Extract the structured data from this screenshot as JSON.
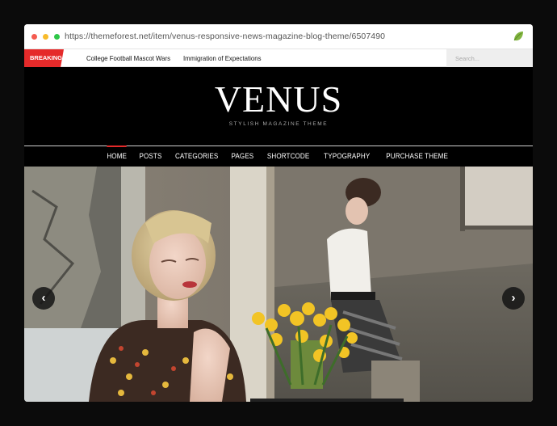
{
  "browser": {
    "url": "https://themeforest.net/item/venus-responsive-news-magazine-blog-theme/6507490"
  },
  "breaking": {
    "label": "BREAKING",
    "items": [
      "College Football Mascot Wars",
      "Immigration of Expectations"
    ]
  },
  "search": {
    "placeholder": "Search..."
  },
  "header": {
    "logo": "VENUS",
    "tagline": "STYLISH MAGAZINE THEME"
  },
  "nav": {
    "items": [
      "HOME",
      "POSTS",
      "CATEGORIES",
      "PAGES",
      "SHORTCODE",
      "TYPOGRAPHY",
      "PURCHASE THEME"
    ],
    "active": "HOME"
  },
  "slider": {
    "prev_icon": "chevron-left-icon",
    "next_icon": "chevron-right-icon",
    "prev": "‹",
    "next": "›"
  },
  "colors": {
    "accent": "#e52a2a",
    "header_bg": "#000000"
  }
}
